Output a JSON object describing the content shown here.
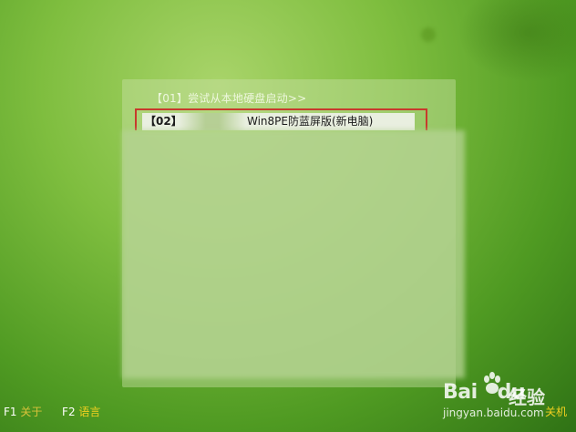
{
  "menu": {
    "item_1": "【01】尝试从本地硬盘启动>>",
    "selected": {
      "number": "【02】",
      "label": "Win8PE防蓝屏版(新电脑)"
    }
  },
  "footer": {
    "f1_key": "F1",
    "f1_label": "关于",
    "f2_key": "F2",
    "f2_label": "语言",
    "right_label": "关机"
  },
  "watermark": {
    "brand_latin": "Bai",
    "brand_latin_2": "du",
    "brand_cn": "经验",
    "url": "jingyan.baidu.com"
  },
  "colors": {
    "selection_border": "#c73a2c",
    "footer_label": "#f2d020"
  }
}
